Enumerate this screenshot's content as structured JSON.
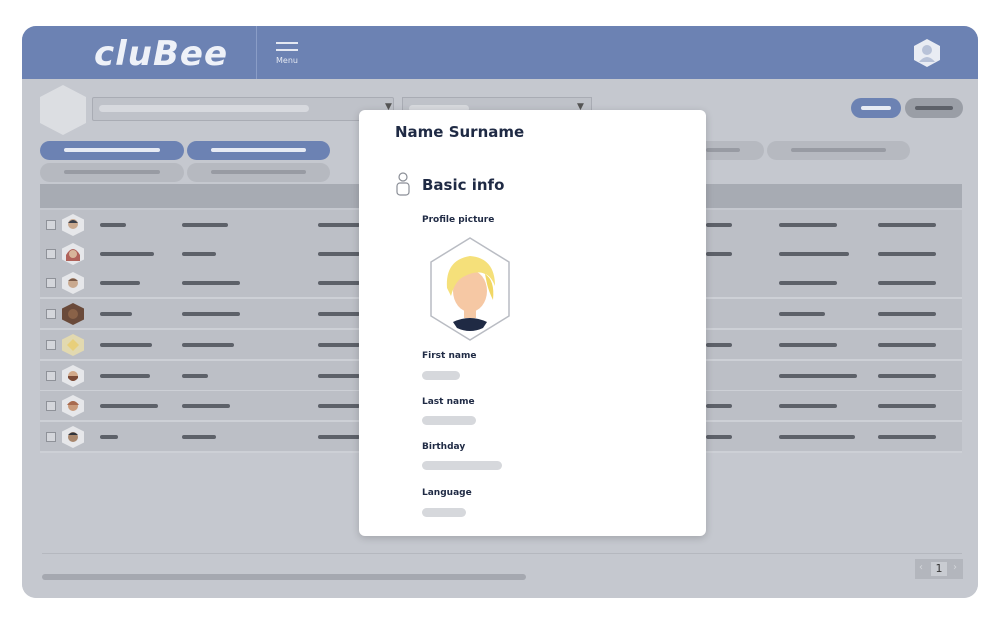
{
  "app": {
    "logo_text": "cluBee",
    "menu_label": "Menu"
  },
  "modal": {
    "title": "Name Surname",
    "section_title": "Basic info",
    "profile_picture_label": "Profile picture",
    "first_name_label": "First name",
    "last_name_label": "Last name",
    "birthday_label": "Birthday",
    "language_label": "Language"
  },
  "pagination": {
    "current_page": "1",
    "prev_icon": "chevron-left-icon",
    "next_icon": "chevron-right-icon"
  },
  "colors": {
    "brand": "#6c82b3",
    "overlay_bg": "#c5c8cf",
    "modal_bg": "#ffffff",
    "text_dark": "#1f2a44"
  }
}
